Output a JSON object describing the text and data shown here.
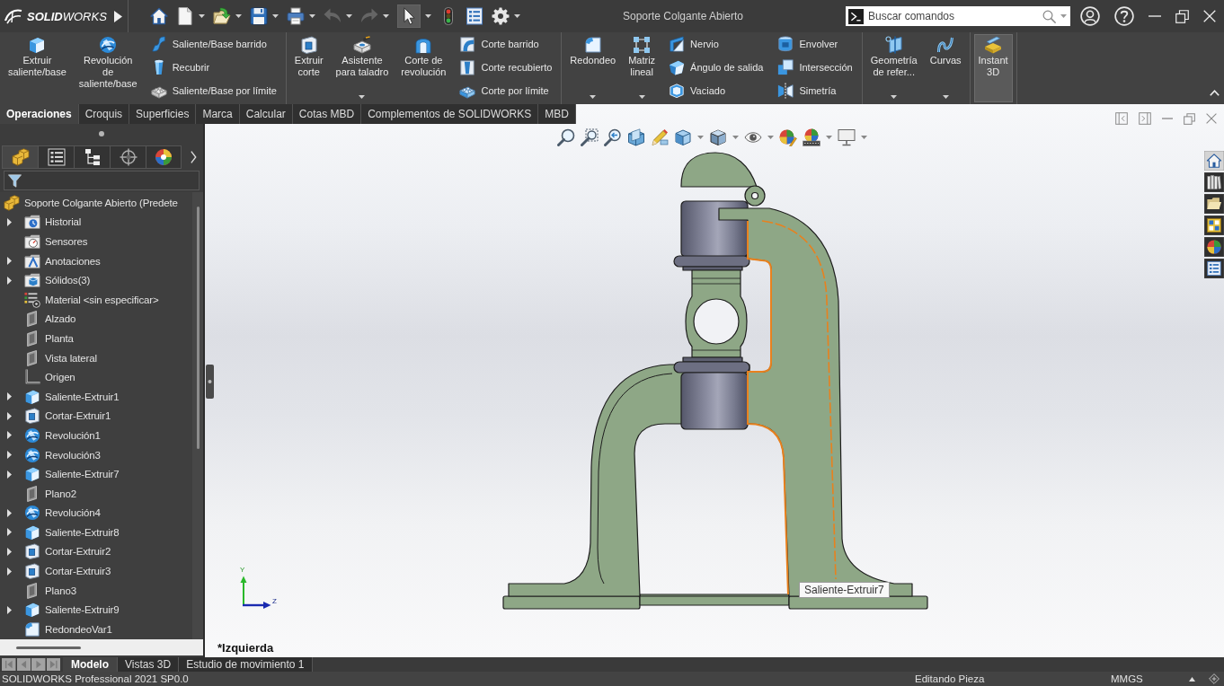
{
  "window": {
    "title": "Soporte Colgante Abierto"
  },
  "logo": {
    "text": "**SOLID**WORKS"
  },
  "quick_access": [
    {
      "dropdown": false,
      "disabled": false,
      "selected": false
    },
    {
      "dropdown": true,
      "disabled": false,
      "selected": false
    },
    {
      "dropdown": true,
      "disabled": false,
      "selected": false
    },
    {
      "dropdown": true,
      "disabled": false,
      "selected": false
    },
    {
      "dropdown": true,
      "disabled": false,
      "selected": false
    },
    {
      "dropdown": true,
      "disabled": true,
      "selected": false
    },
    {
      "dropdown": true,
      "disabled": true,
      "selected": false
    },
    {
      "dropdown": true,
      "disabled": false,
      "selected": true
    },
    {
      "dropdown": false,
      "disabled": false,
      "selected": false
    },
    {
      "dropdown": false,
      "disabled": false,
      "selected": false
    },
    {
      "dropdown": true,
      "disabled": false,
      "selected": false
    }
  ],
  "search": {
    "placeholder": "Buscar comandos"
  },
  "ribbon": {
    "groups": [
      {
        "buttons": [
          {
            "kind": "large",
            "lines": [
              "Extruir",
              "saliente/base"
            ],
            "dropdown": false,
            "on": false
          },
          {
            "kind": "large",
            "lines": [
              "Revolución",
              "de",
              "saliente/base"
            ],
            "dropdown": false,
            "on": false
          },
          {
            "kind": "small",
            "lines": [
              "Saliente/Base barrido"
            ],
            "dropdown": false,
            "on": false
          },
          {
            "kind": "small",
            "lines": [
              "Recubrir"
            ],
            "dropdown": false,
            "on": false
          },
          {
            "kind": "small",
            "lines": [
              "Saliente/Base por límite"
            ],
            "dropdown": false,
            "on": false
          }
        ]
      },
      {
        "buttons": [
          {
            "kind": "large",
            "lines": [
              "Extruir",
              "corte"
            ],
            "dropdown": false,
            "on": false
          },
          {
            "kind": "large",
            "lines": [
              "Asistente",
              "para taladro"
            ],
            "dropdown": true,
            "on": false
          },
          {
            "kind": "large",
            "lines": [
              "Corte de",
              "revolución"
            ],
            "dropdown": false,
            "on": false
          },
          {
            "kind": "small",
            "lines": [
              "Corte barrido"
            ],
            "dropdown": false,
            "on": false
          },
          {
            "kind": "small",
            "lines": [
              "Corte recubierto"
            ],
            "dropdown": false,
            "on": false
          },
          {
            "kind": "small",
            "lines": [
              "Corte por límite"
            ],
            "dropdown": false,
            "on": false
          }
        ]
      },
      {
        "buttons": [
          {
            "kind": "large",
            "lines": [
              "Redondeo"
            ],
            "dropdown": true,
            "on": false
          },
          {
            "kind": "large",
            "lines": [
              "Matriz",
              "lineal"
            ],
            "dropdown": true,
            "on": false
          },
          {
            "kind": "small",
            "lines": [
              "Nervio"
            ],
            "dropdown": false,
            "on": false
          },
          {
            "kind": "small",
            "lines": [
              "Ángulo de salida"
            ],
            "dropdown": false,
            "on": false
          },
          {
            "kind": "small",
            "lines": [
              "Vaciado"
            ],
            "dropdown": false,
            "on": false
          },
          {
            "kind": "small",
            "lines": [
              "Envolver"
            ],
            "dropdown": false,
            "on": false
          },
          {
            "kind": "small",
            "lines": [
              "Intersección"
            ],
            "dropdown": false,
            "on": false
          },
          {
            "kind": "small",
            "lines": [
              "Simetría"
            ],
            "dropdown": false,
            "on": false
          }
        ]
      },
      {
        "buttons": [
          {
            "kind": "large",
            "lines": [
              "Geometría",
              "de refer..."
            ],
            "dropdown": true,
            "on": false
          },
          {
            "kind": "large",
            "lines": [
              "Curvas"
            ],
            "dropdown": true,
            "on": false
          }
        ]
      },
      {
        "buttons": [
          {
            "kind": "large",
            "lines": [
              "Instant",
              "3D"
            ],
            "dropdown": false,
            "on": true
          }
        ]
      }
    ]
  },
  "command_tabs": [
    {
      "label": "Operaciones",
      "selected": true
    },
    {
      "label": "Croquis",
      "selected": false
    },
    {
      "label": "Superficies",
      "selected": false
    },
    {
      "label": "Marca",
      "selected": false
    },
    {
      "label": "Calcular",
      "selected": false
    },
    {
      "label": "Cotas MBD",
      "selected": false
    },
    {
      "label": "Complementos de SOLIDWORKS",
      "selected": false
    },
    {
      "label": "MBD",
      "selected": false
    }
  ],
  "feature_manager": {
    "tabs": [
      {
        "selected": true
      },
      {
        "selected": false
      },
      {
        "selected": false
      },
      {
        "selected": false
      },
      {
        "selected": false
      }
    ],
    "tree": {
      "root": {
        "label": "Soporte Colgante Abierto (Predete",
        "children": [
          {
            "label": "Historial",
            "kind": "history",
            "collapsed": true
          },
          {
            "label": "Sensores",
            "kind": "sensors",
            "collapsed": false
          },
          {
            "label": "Anotaciones",
            "kind": "annotations",
            "collapsed": true
          },
          {
            "label": "Sólidos(3)",
            "kind": "bodies",
            "collapsed": true
          },
          {
            "label": "Material <sin especificar>",
            "kind": "material",
            "collapsed": false
          },
          {
            "label": "Alzado",
            "kind": "plane",
            "collapsed": false
          },
          {
            "label": "Planta",
            "kind": "plane",
            "collapsed": false
          },
          {
            "label": "Vista lateral",
            "kind": "plane",
            "collapsed": false
          },
          {
            "label": "Origen",
            "kind": "origin",
            "collapsed": false
          },
          {
            "label": "Saliente-Extruir1",
            "kind": "extrude",
            "collapsed": true
          },
          {
            "label": "Cortar-Extruir1",
            "kind": "cut",
            "collapsed": true
          },
          {
            "label": "Revolución1",
            "kind": "revolve",
            "collapsed": true
          },
          {
            "label": "Revolución3",
            "kind": "revolve",
            "collapsed": true
          },
          {
            "label": "Saliente-Extruir7",
            "kind": "extrude",
            "collapsed": true
          },
          {
            "label": "Plano2",
            "kind": "plane",
            "collapsed": false
          },
          {
            "label": "Revolución4",
            "kind": "revolve",
            "collapsed": true
          },
          {
            "label": "Saliente-Extruir8",
            "kind": "extrude",
            "collapsed": true
          },
          {
            "label": "Cortar-Extruir2",
            "kind": "cut",
            "collapsed": true
          },
          {
            "label": "Cortar-Extruir3",
            "kind": "cut",
            "collapsed": true
          },
          {
            "label": "Plano3",
            "kind": "plane",
            "collapsed": false
          },
          {
            "label": "Saliente-Extruir9",
            "kind": "extrude",
            "collapsed": true
          },
          {
            "label": "RedondeoVar1",
            "kind": "fillet",
            "collapsed": false
          }
        ]
      }
    }
  },
  "viewport": {
    "view_toolbar": [
      {
        "dropdown": false
      },
      {
        "dropdown": false
      },
      {
        "dropdown": false
      },
      {
        "dropdown": false
      },
      {
        "dropdown": false
      },
      {
        "dropdown": true
      },
      {
        "dropdown": true
      },
      {
        "dropdown": true
      },
      {
        "dropdown": false
      },
      {
        "dropdown": true
      },
      {
        "dropdown": true
      }
    ],
    "task_pane": [
      {
        "selected": true
      },
      {
        "selected": false
      },
      {
        "selected": false
      },
      {
        "selected": false
      },
      {
        "selected": false
      },
      {
        "selected": false
      }
    ],
    "tooltip": "Saliente-Extruir7",
    "triad": {
      "y_label": "Y",
      "z_label": "Z"
    },
    "view_name": "*Izquierda"
  },
  "model_tabs": [
    {
      "label": "Modelo",
      "selected": true
    },
    {
      "label": "Vistas 3D",
      "selected": false
    },
    {
      "label": "Estudio de movimiento 1",
      "selected": false
    }
  ],
  "status_bar": {
    "product": "SOLIDWORKS Professional 2021 SP0.0",
    "mode": "Editando Pieza",
    "units": "MMGS"
  }
}
